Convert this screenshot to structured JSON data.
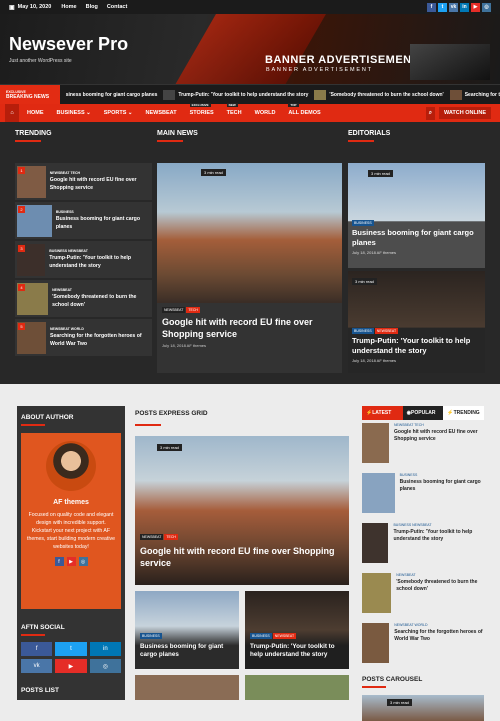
{
  "topbar": {
    "date": "May 10, 2020",
    "links": [
      "Home",
      "Blog",
      "Contact"
    ],
    "social": [
      {
        "icon": "facebook-icon",
        "glyph": "f",
        "color": "#3b5998"
      },
      {
        "icon": "twitter-icon",
        "glyph": "t",
        "color": "#1da1f2"
      },
      {
        "icon": "vk-icon",
        "glyph": "vk",
        "color": "#4a76a8"
      },
      {
        "icon": "linkedin-icon",
        "glyph": "in",
        "color": "#0077b5"
      },
      {
        "icon": "youtube-icon",
        "glyph": "▶",
        "color": "#e52d27"
      },
      {
        "icon": "instagram-icon",
        "glyph": "◎",
        "color": "#3f729b"
      }
    ]
  },
  "brand": {
    "name": "Newsever Pro",
    "tagline": "Just another WordPress site",
    "ad_title": "BANNER ADVERTISEMENT",
    "ad_sub": "BANNER ADVERTISEMENT"
  },
  "ticker": {
    "tag": "EXCLUSIVE",
    "label": "BREAKING NEWS",
    "items": [
      "siness booming for giant cargo planes",
      "Trump-Putin: 'Your toolkit to help understand the story",
      "'Somebody threatened to burn the school down'",
      "Searching for t"
    ]
  },
  "nav": {
    "items": [
      "HOME",
      "BUSINESS ⌄",
      "SPORTS ⌄",
      "NEWSBEAT",
      "STORIES",
      "TECH",
      "WORLD",
      "ALL DEMOS"
    ],
    "badges": {
      "STORIES": "EXCLUSIVE",
      "TECH": "NEW",
      "ALL DEMOS": "TOP"
    },
    "watch": "WATCH ONLINE"
  },
  "sections": {
    "trending": "TRENDING",
    "main": "MAIN NEWS",
    "editorials": "EDITORIALS",
    "about": "ABOUT AUTHOR",
    "grid": "POSTS EXPRESS GRID",
    "social": "AFTN SOCIAL",
    "posts_list": "POSTS LIST",
    "carousel": "POSTS CAROUSEL"
  },
  "trending": [
    {
      "n": "1",
      "cats": "NEWSBEAT  TECH",
      "title": "Google hit with record EU fine over Shopping service",
      "color": "#7f5b44"
    },
    {
      "n": "2",
      "cats": "BUSINESS",
      "title": "Business booming for giant cargo planes",
      "color": "#6d8db0"
    },
    {
      "n": "3",
      "cats": "BUSINESS  NEWSBEAT",
      "title": "Trump-Putin: 'Your toolkit to help understand the story",
      "color": "#3c2f2a"
    },
    {
      "n": "4",
      "cats": "NEWSBEAT",
      "title": "'Somebody threatened to burn the school down'",
      "color": "#8a7b4a"
    },
    {
      "n": "5",
      "cats": "NEWSBEAT  WORLD",
      "title": "Searching for the forgotten heroes of World War Two",
      "color": "#6e4f38"
    }
  ],
  "main": {
    "read": "3 min read",
    "cats": [
      "NEWSBEAT",
      "TECH"
    ],
    "title": "Google hit with record EU fine over Shopping service",
    "meta": "July 18, 2018   AF themes"
  },
  "editorials": [
    {
      "read": "3 min read",
      "cats": [
        "BUSINESS"
      ],
      "title": "Business booming for giant cargo planes",
      "meta": "July 18, 2018   AF themes"
    },
    {
      "read": "3 min read",
      "cats": [
        "BUSINESS",
        "NEWSBEAT"
      ],
      "title": "Trump-Putin: 'Your toolkit to help understand the story",
      "meta": "July 18, 2018   AF themes"
    }
  ],
  "author": {
    "name": "AF themes",
    "bio": "Focused on quality code and elegant design with incredible support. Kickstart your next project with AF themes, start building modern creative websites today!"
  },
  "grid": {
    "big": {
      "read": "3 min read",
      "cats": [
        "NEWSBEAT",
        "TECH"
      ],
      "title": "Google hit with record EU fine over Shopping service"
    },
    "small": [
      {
        "cats": [
          "BUSINESS"
        ],
        "title": "Business booming for giant cargo planes"
      },
      {
        "cats": [
          "BUSINESS",
          "NEWSBEAT"
        ],
        "title": "Trump-Putin: 'Your toolkit to help understand the story"
      }
    ]
  },
  "tabs": [
    "LATEST",
    "POPULAR",
    "TRENDING"
  ],
  "latest": [
    {
      "cats": "NEWSBEAT  TECH",
      "title": "Google hit with record EU fine over Shopping service",
      "color": "#8a6a4f"
    },
    {
      "cats": "BUSINESS",
      "title": "Business booming for giant cargo planes",
      "color": "#88a3c0"
    },
    {
      "cats": "BUSINESS  NEWSBEAT",
      "title": "Trump-Putin: 'Your toolkit to help understand the story",
      "color": "#3e332d"
    },
    {
      "cats": "NEWSBEAT",
      "title": "'Somebody threatened to burn the school down'",
      "color": "#9a8a50"
    },
    {
      "cats": "NEWSBEAT  WORLD",
      "title": "Searching for the forgotten heroes of World War Two",
      "color": "#7a5a40"
    }
  ],
  "carousel_read": "3 min read"
}
